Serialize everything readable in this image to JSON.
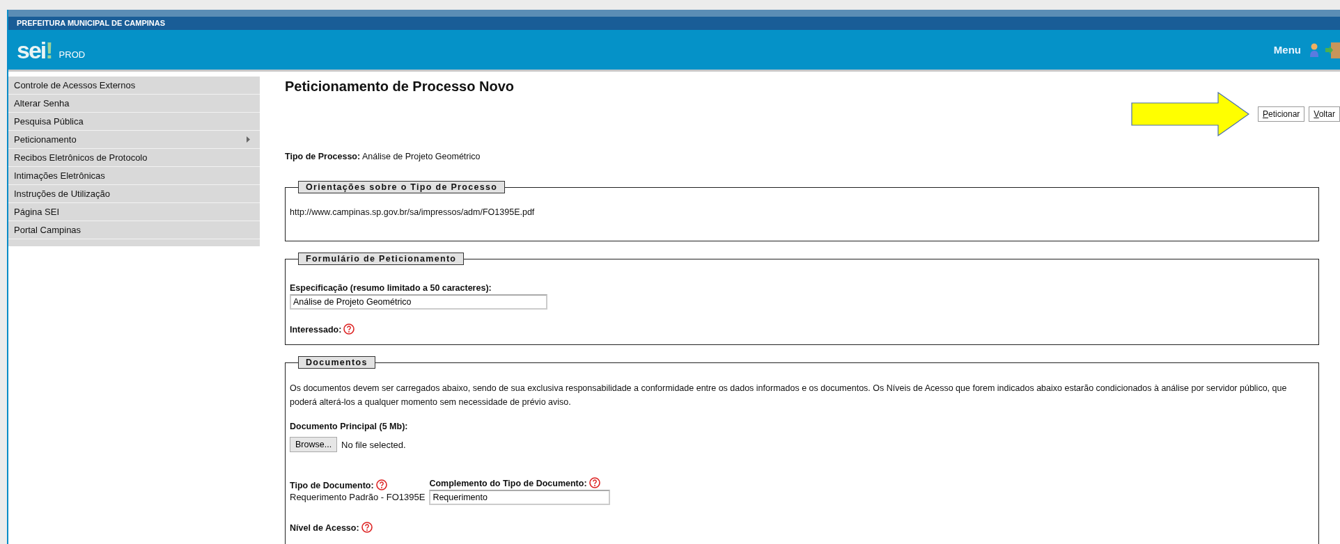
{
  "header": {
    "org": "PREFEITURA MUNICIPAL DE CAMPINAS",
    "logo": "sei!",
    "environment": "PROD",
    "menu": "Menu"
  },
  "sidebar": {
    "items": [
      {
        "label": "Controle de Acessos Externos",
        "expandable": false
      },
      {
        "label": "Alterar Senha",
        "expandable": false
      },
      {
        "label": "Pesquisa Pública",
        "expandable": false
      },
      {
        "label": "Peticionamento",
        "expandable": true
      },
      {
        "label": "Recibos Eletrônicos de Protocolo",
        "expandable": false
      },
      {
        "label": "Intimações Eletrônicas",
        "expandable": false
      },
      {
        "label": "Instruções de Utilização",
        "expandable": false
      },
      {
        "label": "Página SEI",
        "expandable": false
      },
      {
        "label": "Portal Campinas",
        "expandable": false
      }
    ]
  },
  "page_title": "Peticionamento de Processo Novo",
  "buttons": [
    {
      "label": "Peticionar"
    },
    {
      "label": "Voltar"
    }
  ],
  "process_type": "**Tipo de Processo:** Análise de Projeto Geométrico",
  "guidance": {
    "legend": "Orientações sobre o Tipo de Processo",
    "text": "http://www.campinas.sp.gov.br/sa/impressos/adm/FO1395E.pdf"
  },
  "form": {
    "legend": "Formulário de Peticionamento",
    "specification_label": "Especificação (resumo limitado a 50 caracteres):",
    "specification_value": "Análise de Projeto Geométrico",
    "interested_label": "Interessado:"
  },
  "documents": {
    "legend": "Documentos",
    "notice": "Os documentos devem ser carregados abaixo, sendo de sua exclusiva responsabilidade a conformidade entre os dados informados e os documentos. Os Níveis de Acesso que forem indicados abaixo estarão condicionados à análise por servidor público, que poderá alterá-los a qualquer momento sem necessidade de prévio aviso.",
    "main_document_label": "Documento Principal (5 Mb):",
    "browse_button": "Browse...",
    "file_status": "No file selected.",
    "document_type_label": "Tipo de Documento:",
    "document_type_value": "Requerimento Padrão - FO1395E",
    "complement_label": "Complemento do Tipo de Documento:",
    "complement_value": "Requerimento",
    "access_level_label": "Nível de Acesso:"
  }
}
